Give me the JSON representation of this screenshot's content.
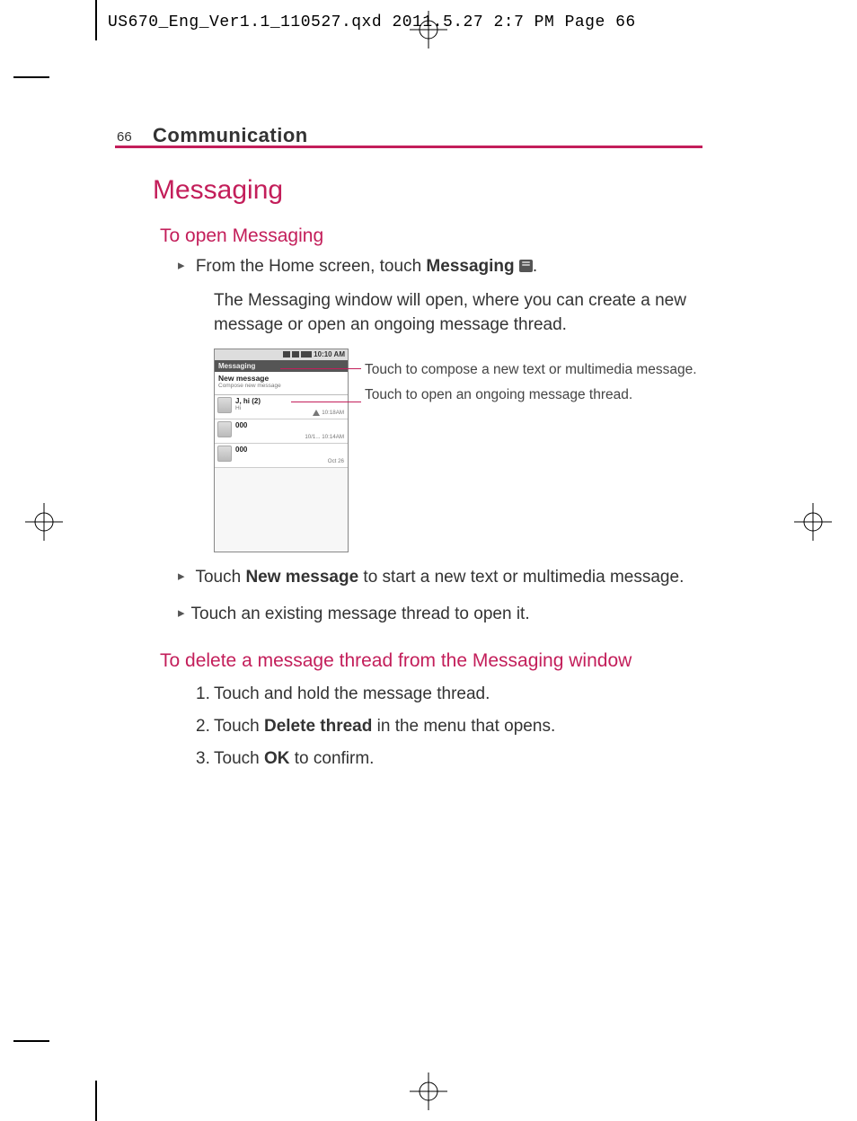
{
  "slug": "US670_Eng_Ver1.1_110527.qxd  2011.5.27  2:7 PM  Page 66",
  "page_number": "66",
  "chapter": "Communication",
  "title": "Messaging",
  "section1": {
    "heading": "To open Messaging",
    "bullet1_pre": "From the Home screen, touch ",
    "bullet1_bold": "Messaging",
    "bullet1_post": ".",
    "para": "The Messaging window will open, where you can create a new message or open an ongoing message thread.",
    "callout1": "Touch to compose a new text or multimedia message.",
    "callout2": "Touch to open an ongoing message thread.",
    "bullet2_pre": "Touch ",
    "bullet2_bold": "New message",
    "bullet2_post": " to start a new text or multimedia message.",
    "bullet3": "Touch an existing message thread to open it."
  },
  "section2": {
    "heading": "To delete a message thread from the Messaging window",
    "step1": "Touch and hold the message thread.",
    "step2_pre": "Touch ",
    "step2_bold": "Delete thread",
    "step2_post": " in the menu that opens.",
    "step3_pre": "Touch ",
    "step3_bold": "OK",
    "step3_post": " to confirm."
  },
  "phone": {
    "time": "10:10 AM",
    "title": "Messaging",
    "new_message": "New message",
    "compose_hint": "Compose new message",
    "threads": [
      {
        "name": "J, hi (2)",
        "preview": "Hi",
        "meta": "10:18AM",
        "warn": true
      },
      {
        "name": "000",
        "preview": "",
        "meta": "10/1... 10:14AM",
        "warn": false
      },
      {
        "name": "000",
        "preview": "",
        "meta": "Oct 26",
        "warn": false
      }
    ]
  }
}
